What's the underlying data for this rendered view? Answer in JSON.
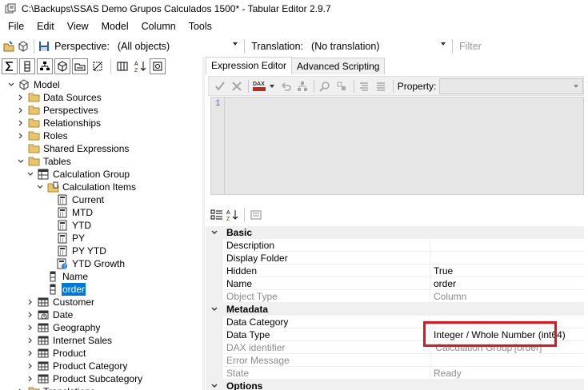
{
  "window": {
    "title": "C:\\Backups\\SSAS Demo Grupos Calculados 1500* - Tabular Editor 2.9.7"
  },
  "menu": [
    "File",
    "Edit",
    "View",
    "Model",
    "Column",
    "Tools"
  ],
  "toolbar": {
    "perspective_label": "Perspective:",
    "perspective_value": "(All objects)",
    "translation_label": "Translation:",
    "translation_value": "(No translation)",
    "filter_placeholder": "Filter"
  },
  "tree": {
    "model_label": "Model",
    "items": [
      {
        "label": "Model",
        "level": 0,
        "expander": "open",
        "icon": "model-cube-icon"
      },
      {
        "label": "Data Sources",
        "level": 1,
        "expander": "closed",
        "icon": "folder-icon"
      },
      {
        "label": "Perspectives",
        "level": 1,
        "expander": "closed",
        "icon": "folder-icon"
      },
      {
        "label": "Relationships",
        "level": 1,
        "expander": "closed",
        "icon": "folder-icon"
      },
      {
        "label": "Roles",
        "level": 1,
        "expander": "closed",
        "icon": "folder-icon"
      },
      {
        "label": "Shared Expressions",
        "level": 1,
        "expander": "none",
        "icon": "folder-icon"
      },
      {
        "label": "Tables",
        "level": 1,
        "expander": "open",
        "icon": "folder-icon"
      },
      {
        "label": "Calculation Group",
        "level": 2,
        "expander": "open",
        "icon": "calc-group-table-icon"
      },
      {
        "label": "Calculation Items",
        "level": 3,
        "expander": "open",
        "icon": "calc-items-folder-icon"
      },
      {
        "label": "Current",
        "level": 4,
        "expander": "none",
        "icon": "calculator-icon"
      },
      {
        "label": "MTD",
        "level": 4,
        "expander": "none",
        "icon": "calculator-icon"
      },
      {
        "label": "YTD",
        "level": 4,
        "expander": "none",
        "icon": "calculator-icon"
      },
      {
        "label": "PY",
        "level": 4,
        "expander": "none",
        "icon": "calculator-icon"
      },
      {
        "label": "PY YTD",
        "level": 4,
        "expander": "none",
        "icon": "calculator-icon"
      },
      {
        "label": "YTD Growth",
        "level": 4,
        "expander": "none",
        "icon": "calculator-warning-icon"
      },
      {
        "label": "Name",
        "level": 3,
        "expander": "none",
        "icon": "column-icon"
      },
      {
        "label": "order",
        "level": 3,
        "expander": "none",
        "icon": "column-icon",
        "selected": true
      },
      {
        "label": "Customer",
        "level": 2,
        "expander": "closed",
        "icon": "table-icon"
      },
      {
        "label": "Date",
        "level": 2,
        "expander": "closed",
        "icon": "date-table-icon"
      },
      {
        "label": "Geography",
        "level": 2,
        "expander": "closed",
        "icon": "table-icon"
      },
      {
        "label": "Internet Sales",
        "level": 2,
        "expander": "closed",
        "icon": "table-icon"
      },
      {
        "label": "Product",
        "level": 2,
        "expander": "closed",
        "icon": "table-icon"
      },
      {
        "label": "Product Category",
        "level": 2,
        "expander": "closed",
        "icon": "table-icon"
      },
      {
        "label": "Product Subcategory",
        "level": 2,
        "expander": "closed",
        "icon": "table-icon"
      },
      {
        "label": "Translations",
        "level": 1,
        "expander": "closed",
        "icon": "folder-icon"
      }
    ]
  },
  "tabs": [
    "Expression Editor",
    "Advanced Scripting"
  ],
  "editor": {
    "property_label": "Property:",
    "property_value": "",
    "line_number": "1",
    "dax_label": "DAX"
  },
  "properties": [
    {
      "kind": "category",
      "name": "Basic",
      "expander": "open"
    },
    {
      "kind": "prop",
      "name": "Description",
      "value": ""
    },
    {
      "kind": "prop",
      "name": "Display Folder",
      "value": ""
    },
    {
      "kind": "prop",
      "name": "Hidden",
      "value": "True"
    },
    {
      "kind": "prop",
      "name": "Name",
      "value": "order"
    },
    {
      "kind": "prop",
      "name": "Object Type",
      "value": "Column",
      "dim": true
    },
    {
      "kind": "category",
      "name": "Metadata",
      "expander": "open"
    },
    {
      "kind": "prop",
      "name": "Data Category",
      "value": ""
    },
    {
      "kind": "prop",
      "name": "Data Type",
      "value": "Integer / Whole Number (int64)"
    },
    {
      "kind": "prop",
      "name": "DAX identifier",
      "value": "'Calculation Group'[order]",
      "dim": true
    },
    {
      "kind": "prop",
      "name": "Error Message",
      "value": "",
      "dim": true
    },
    {
      "kind": "prop",
      "name": "State",
      "value": "Ready",
      "dim": true
    },
    {
      "kind": "category",
      "name": "Options",
      "expander": "open"
    }
  ],
  "colors": {
    "selection": "#0078d7",
    "highlight_border": "#e4141e",
    "folder": "#e8c46a"
  }
}
